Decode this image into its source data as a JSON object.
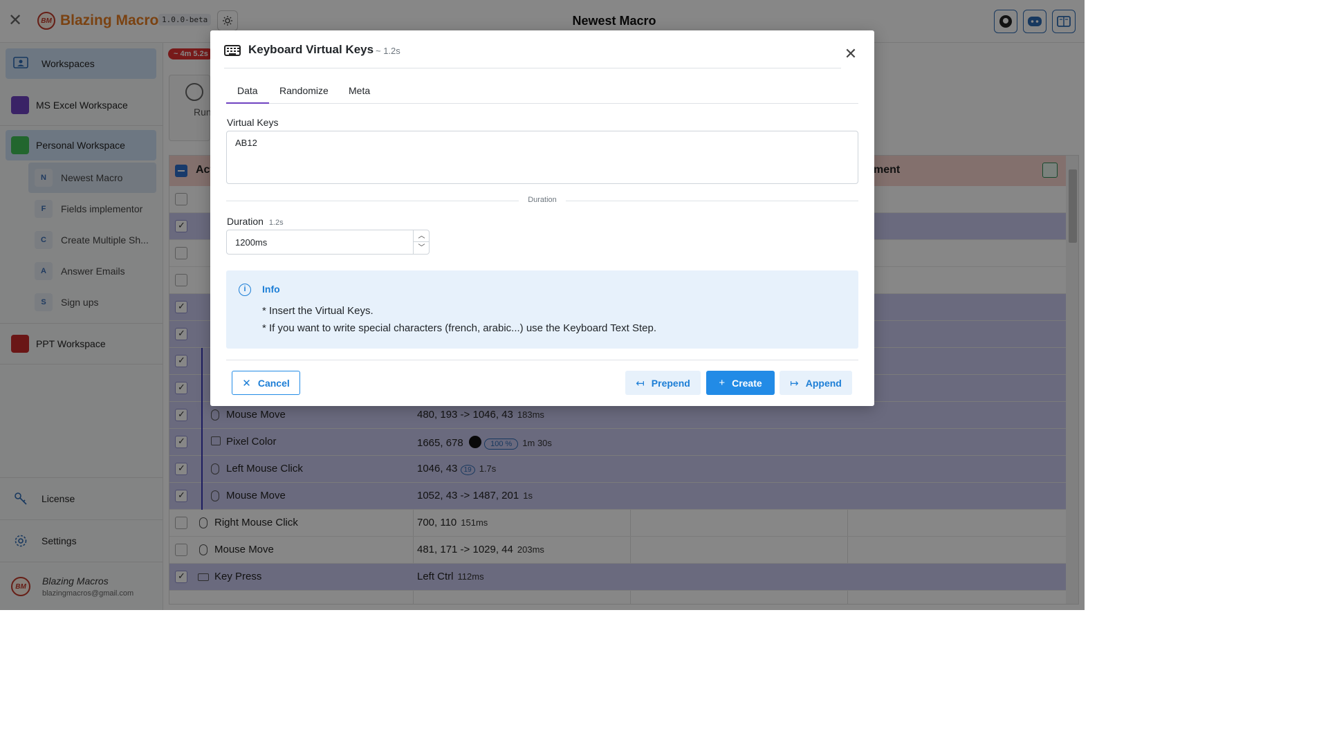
{
  "app": {
    "brand": "Blazing Macros",
    "logo_text": "BM",
    "version": "1.0.0-beta",
    "title": "Newest Macro"
  },
  "sidebar": {
    "workspaces_label": "Workspaces",
    "items": [
      {
        "label": "MS Excel Workspace",
        "color": "#6f42c1"
      },
      {
        "label": "Personal Workspace",
        "color": "#40c057"
      },
      {
        "label": "PPT Workspace",
        "color": "#c92a2a"
      }
    ],
    "macros": [
      {
        "letter": "N",
        "label": "Newest Macro"
      },
      {
        "letter": "F",
        "label": "Fields implementor"
      },
      {
        "letter": "C",
        "label": "Create Multiple Sh..."
      },
      {
        "letter": "A",
        "label": "Answer Emails"
      },
      {
        "letter": "S",
        "label": "Sign ups"
      }
    ],
    "license_label": "License",
    "settings_label": "Settings",
    "user_name": "Blazing Macros",
    "user_email": "blazingmacros@gmail.com"
  },
  "main": {
    "progress": "~ 4m 5.2s",
    "run_label": "Run",
    "table_header_left": "Act",
    "table_header_right": "ment",
    "rows": [
      {
        "name": "Mouse Move",
        "value": "480, 193 -> 1046, 43",
        "dur": "183ms"
      },
      {
        "name": "Pixel Color",
        "value": "1665, 678",
        "pct": "100 %",
        "dur": "1m 30s"
      },
      {
        "name": "Left Mouse Click",
        "value": "1046, 43",
        "badge": "19",
        "dur": "1.7s"
      },
      {
        "name": "Mouse Move",
        "value": "1052, 43 -> 1487, 201",
        "dur": "1s"
      },
      {
        "name": "Right Mouse Click",
        "value": "700, 110",
        "dur": "151ms"
      },
      {
        "name": "Mouse Move",
        "value": "481, 171 -> 1029, 44",
        "dur": "203ms"
      },
      {
        "name": "Key Press",
        "value": "Left Ctrl",
        "dur": "112ms"
      }
    ]
  },
  "modal": {
    "title": "Keyboard Virtual Keys",
    "subtitle": "~ 1.2s",
    "tabs": [
      "Data",
      "Randomize",
      "Meta"
    ],
    "virtual_keys_label": "Virtual Keys",
    "virtual_keys_value": "AB12",
    "duration_separator": "Duration",
    "duration_label": "Duration",
    "duration_hint": "1.2s",
    "duration_value": "1200ms",
    "info_title": "Info",
    "info_lines": [
      "* Insert the Virtual Keys.",
      "* If you want to write special characters (french, arabic...) use the Keyboard Text Step."
    ],
    "cancel_label": "Cancel",
    "prepend_label": "Prepend",
    "create_label": "Create",
    "append_label": "Append"
  }
}
